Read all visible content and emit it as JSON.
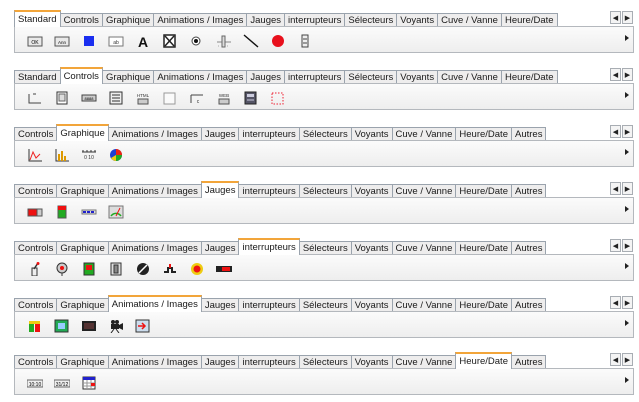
{
  "panels": [
    {
      "tabs": [
        "Standard",
        "Controls",
        "Graphique",
        "Animations / Images",
        "Jauges",
        "interrupteurs",
        "Sélecteurs",
        "Voyants",
        "Cuve / Vanne",
        "Heure/Date"
      ],
      "active": 0,
      "icons": [
        "ok-button-icon",
        "cancel-button-icon",
        "blue-square-icon",
        "textbox-icon",
        "text-a-icon",
        "checkbox-cross-icon",
        "radio-button-icon",
        "slider-icon",
        "line-icon",
        "red-circle-icon",
        "scrollbar-icon"
      ]
    },
    {
      "tabs": [
        "Standard",
        "Controls",
        "Graphique",
        "Animations / Images",
        "Jauges",
        "interrupteurs",
        "Sélecteurs",
        "Voyants",
        "Cuve / Vanne",
        "Heure/Date"
      ],
      "active": 1,
      "icons": [
        "frame-icon",
        "tablet-icon",
        "display-icon",
        "list-icon",
        "html-icon",
        "blank-box-icon",
        "combo-icon",
        "web-icon",
        "document-icon",
        "dotted-box-icon"
      ]
    },
    {
      "tabs": [
        "Controls",
        "Graphique",
        "Animations / Images",
        "Jauges",
        "interrupteurs",
        "Sélecteurs",
        "Voyants",
        "Cuve / Vanne",
        "Heure/Date",
        "Autres"
      ],
      "active": 1,
      "icons": [
        "line-chart-icon",
        "bar-chart-icon",
        "scale-icon",
        "pie-chart-icon"
      ]
    },
    {
      "tabs": [
        "Controls",
        "Graphique",
        "Animations / Images",
        "Jauges",
        "interrupteurs",
        "Sélecteurs",
        "Voyants",
        "Cuve / Vanne",
        "Heure/Date",
        "Autres"
      ],
      "active": 3,
      "icons": [
        "horizontal-gauge-icon",
        "vertical-gauge-icon",
        "level-bar-icon",
        "dial-gauge-icon"
      ]
    },
    {
      "tabs": [
        "Controls",
        "Graphique",
        "Animations / Images",
        "Jauges",
        "interrupteurs",
        "Sélecteurs",
        "Voyants",
        "Cuve / Vanne",
        "Heure/Date",
        "Autres"
      ],
      "active": 4,
      "icons": [
        "lever-switch-icon",
        "rotary-switch-icon",
        "traffic-switch-icon",
        "panel-switch-icon",
        "stop-button-icon",
        "valve-switch-icon",
        "push-button-icon",
        "toggle-bar-icon"
      ]
    },
    {
      "tabs": [
        "Controls",
        "Graphique",
        "Animations / Images",
        "Jauges",
        "interrupteurs",
        "Sélecteurs",
        "Voyants",
        "Cuve / Vanne",
        "Heure/Date",
        "Autres"
      ],
      "active": 2,
      "icons": [
        "animation-icon",
        "image-icon",
        "video-icon",
        "camera-icon",
        "import-icon"
      ]
    },
    {
      "tabs": [
        "Controls",
        "Graphique",
        "Animations / Images",
        "Jauges",
        "interrupteurs",
        "Sélecteurs",
        "Voyants",
        "Cuve / Vanne",
        "Heure/Date",
        "Autres"
      ],
      "active": 8,
      "icons": [
        "time-display-icon",
        "date-display-icon",
        "calendar-icon"
      ]
    }
  ]
}
